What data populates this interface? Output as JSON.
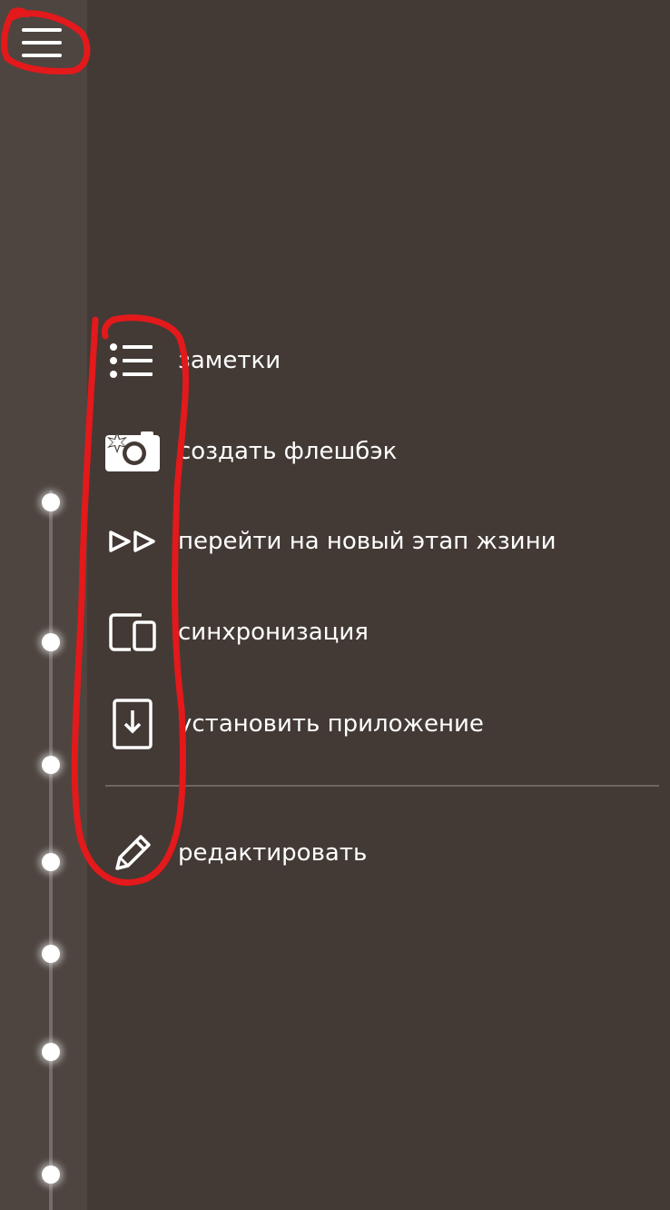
{
  "header": {
    "menu_icon": "hamburger-menu-icon"
  },
  "menu": {
    "items": [
      {
        "label": "заметки",
        "icon": "notes-list-icon"
      },
      {
        "label": "создать флешбэк",
        "icon": "camera-flash-icon"
      },
      {
        "label": "перейти на новый этап жзини",
        "icon": "fast-forward-icon"
      },
      {
        "label": "синхронизация",
        "icon": "devices-sync-icon"
      },
      {
        "label": "установить приложение",
        "icon": "install-download-icon"
      }
    ],
    "edit": {
      "label": "редактировать",
      "icon": "pencil-icon"
    }
  },
  "colors": {
    "background": "#433a35",
    "rail": "#4e4540",
    "text": "#ffffff",
    "annotation": "#e3191b"
  }
}
